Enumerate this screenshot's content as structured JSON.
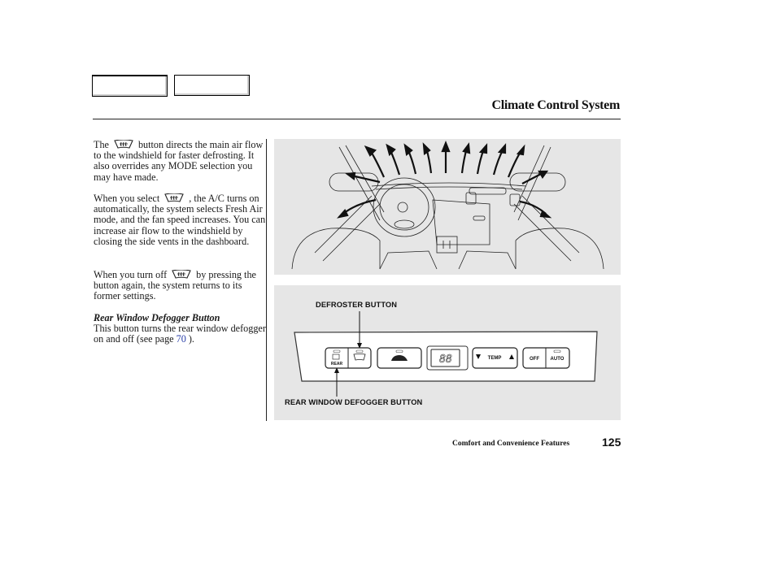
{
  "nav": {
    "buttons": [
      {
        "label": "",
        "name": "nav-box-main-menu"
      },
      {
        "label": "",
        "name": "nav-box-index"
      }
    ]
  },
  "header": {
    "title": "Climate Control System"
  },
  "body": {
    "para1": {
      "before_icon": "The",
      "icon": "windshield-defroster-icon",
      "after_icon": "button directs the main air flow to the windshield for faster defrosting. It also overrides any MODE selection you may have made."
    },
    "para2": {
      "before_icon": "When you select",
      "icon": "windshield-defroster-icon",
      "after_icon": ", the A/C turns on automatically, the system selects Fresh Air mode, and the fan speed increases. You can increase air flow to the windshield by closing the side vents in the dashboard."
    },
    "para3": {
      "before_icon": "When you turn off",
      "icon": "windshield-defroster-icon",
      "after_icon": "by pressing the button again, the system returns to its former settings."
    },
    "para4": {
      "subheading": "Rear Window Defogger Button",
      "text_before_link": "This button turns the rear window defogger on and off  (see page",
      "link_text": "70",
      "text_after_link": ")."
    }
  },
  "figures": {
    "top": {
      "description": "Dashboard illustration with airflow arrows toward windshield and side windows",
      "arrow_count": 14
    },
    "bottom": {
      "callout_defroster": "DEFROSTER BUTTON",
      "callout_rear": "REAR WINDOW DEFOGGER BUTTON",
      "panel_buttons": {
        "rear_label": "REAR",
        "display_value": "88",
        "temp_label": "TEMP",
        "off_label": "OFF",
        "auto_label": "AUTO"
      }
    }
  },
  "footer": {
    "section": "Comfort and Convenience Features",
    "page_number": "125"
  },
  "colors": {
    "link": "#2a3fa8",
    "figure_background": "#e6e6e6"
  }
}
